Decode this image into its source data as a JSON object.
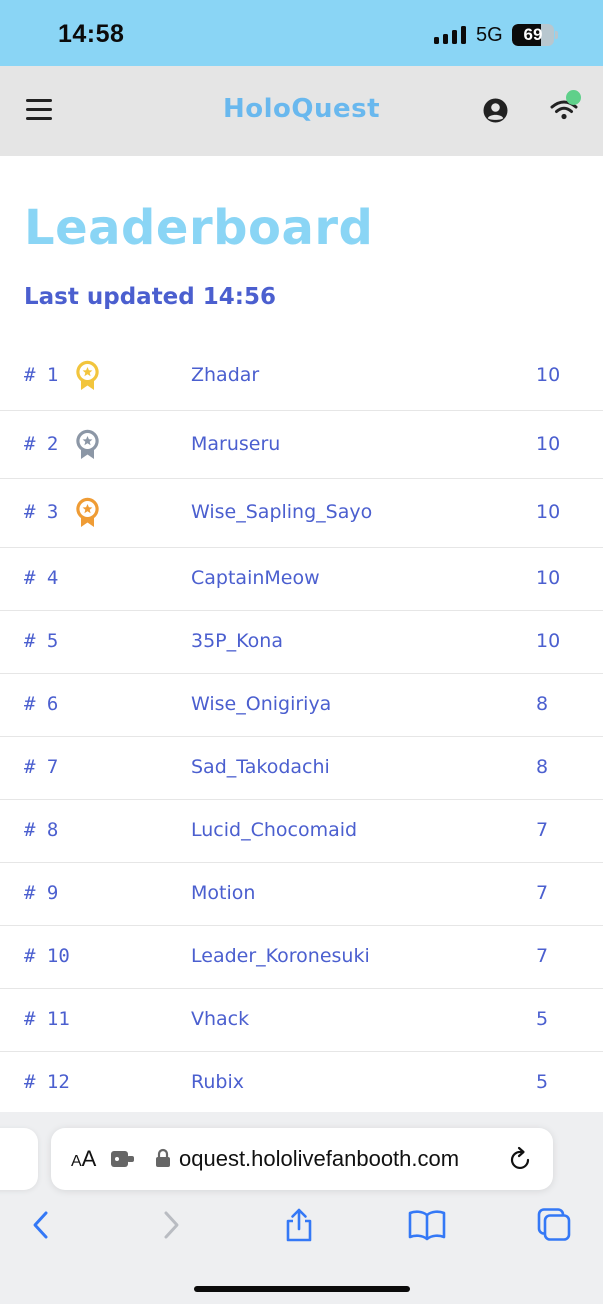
{
  "status_bar": {
    "time": "14:58",
    "network": "5G",
    "battery_level": 69,
    "battery_label": "69"
  },
  "header": {
    "title": "HoloQuest",
    "menu_icon": "hamburger-menu-icon",
    "account_icon": "account-circle-icon",
    "connection_icon": "wifi-icon",
    "connection_status_color": "#5fd08a"
  },
  "page": {
    "heading": "Leaderboard",
    "last_updated": "Last updated 14:56"
  },
  "leaderboard": {
    "rows": [
      {
        "rank": "# 1",
        "name": "Zhadar",
        "score": "10",
        "medal": "gold"
      },
      {
        "rank": "# 2",
        "name": "Maruseru",
        "score": "10",
        "medal": "silver"
      },
      {
        "rank": "# 3",
        "name": "Wise_Sapling_Sayo",
        "score": "10",
        "medal": "bronze"
      },
      {
        "rank": "# 4",
        "name": "CaptainMeow",
        "score": "10"
      },
      {
        "rank": "# 5",
        "name": "35P_Kona",
        "score": "10"
      },
      {
        "rank": "# 6",
        "name": "Wise_Onigiriya",
        "score": "8"
      },
      {
        "rank": "# 7",
        "name": "Sad_Takodachi",
        "score": "8"
      },
      {
        "rank": "# 8",
        "name": "Lucid_Chocomaid",
        "score": "7"
      },
      {
        "rank": "# 9",
        "name": "Motion",
        "score": "7"
      },
      {
        "rank": "# 10",
        "name": "Leader_Koronesuki",
        "score": "7"
      },
      {
        "rank": "# 11",
        "name": "Vhack",
        "score": "5"
      },
      {
        "rank": "# 12",
        "name": "Rubix",
        "score": "5"
      }
    ]
  },
  "medal_colors": {
    "gold": "#f2c53d",
    "silver": "#8c97a6",
    "bronze": "#ef9c35"
  },
  "browser": {
    "aa_small": "A",
    "aa_big": "A",
    "url": "oquest.hololivefanbooth.com",
    "toolbar_icons": [
      "back-icon",
      "forward-icon",
      "share-icon",
      "bookmarks-icon",
      "tabs-icon"
    ]
  },
  "colors": {
    "status_bar_bg": "#8ad5f5",
    "header_bg": "#e5e5e5",
    "title": "#69b8ee",
    "heading": "#8ad5f5",
    "text_accent": "#4b5fcf"
  }
}
